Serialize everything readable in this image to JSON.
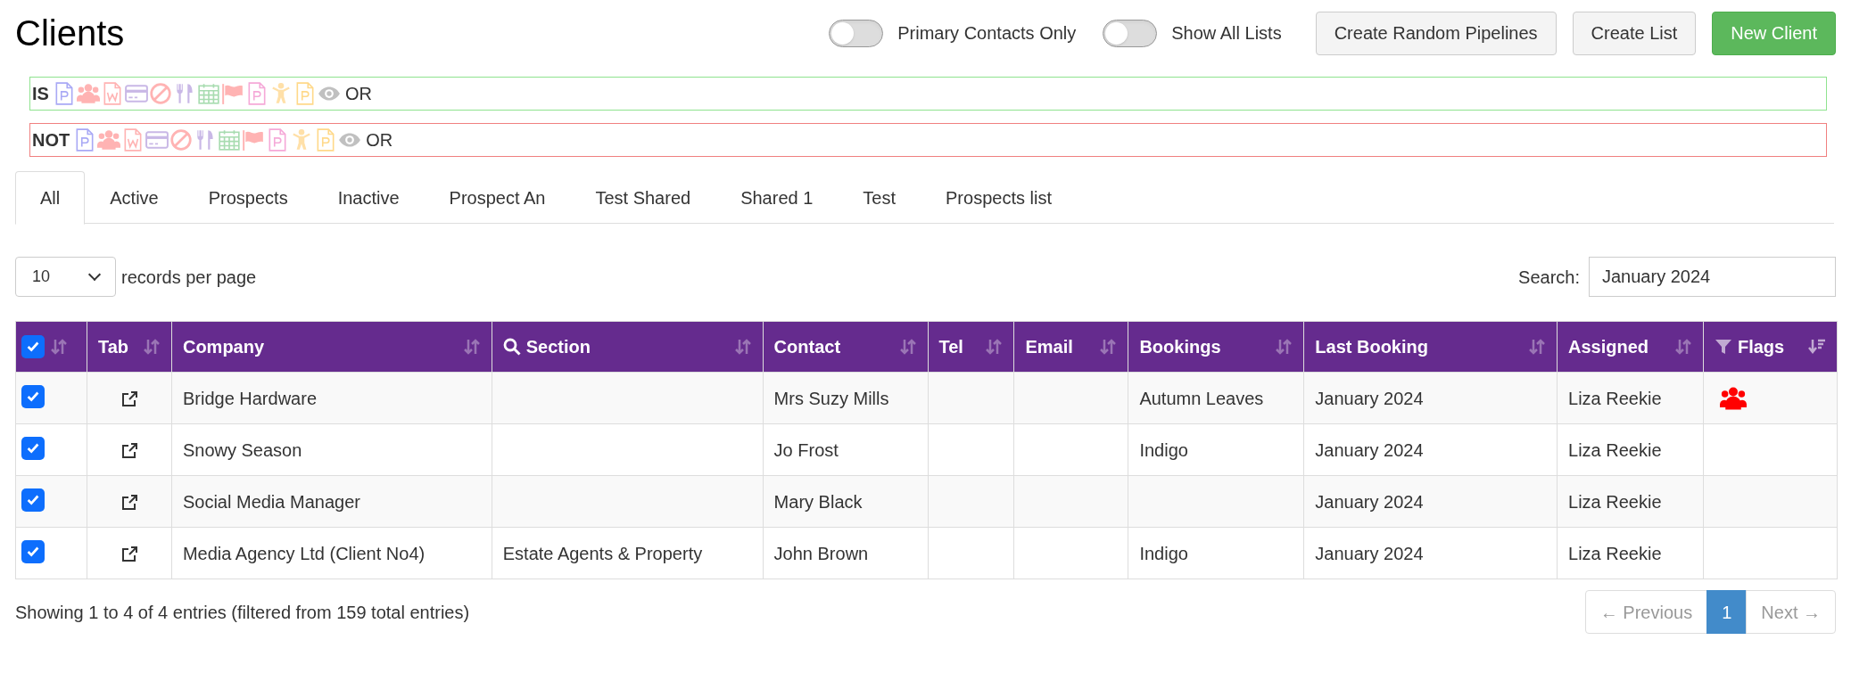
{
  "page_title": "Clients",
  "toggles": [
    {
      "label": "Primary Contacts Only",
      "on": false
    },
    {
      "label": "Show All Lists",
      "on": false
    }
  ],
  "buttons": [
    {
      "label": "Create Random Pipelines",
      "kind": "default"
    },
    {
      "label": "Create List",
      "kind": "default"
    },
    {
      "label": "New Client",
      "kind": "primary"
    }
  ],
  "filters": [
    {
      "label": "IS",
      "kind": "is",
      "joiner": "OR",
      "icons": [
        {
          "kind": "docp",
          "color": "#a9a9f5"
        },
        {
          "kind": "users",
          "color": "#ffb3b3"
        },
        {
          "kind": "docw",
          "color": "#ffb3b3"
        },
        {
          "kind": "card",
          "color": "#c9b8e6"
        },
        {
          "kind": "ban",
          "color": "#ffb3b3"
        },
        {
          "kind": "utensils",
          "color": "#c9b8e6"
        },
        {
          "kind": "calendar",
          "color": "#a8dcb0"
        },
        {
          "kind": "flag",
          "color": "#ffb3b3"
        },
        {
          "kind": "docp",
          "color": "#f5a9d8"
        },
        {
          "kind": "child",
          "color": "#ffe0a8"
        },
        {
          "kind": "docp",
          "color": "#ffd98a"
        },
        {
          "kind": "eye",
          "color": "#c0c0c0"
        }
      ]
    },
    {
      "label": "NOT",
      "kind": "not",
      "joiner": "OR",
      "icons": [
        {
          "kind": "docp",
          "color": "#a9a9f5"
        },
        {
          "kind": "users",
          "color": "#ffb3b3"
        },
        {
          "kind": "docw",
          "color": "#ffb3b3"
        },
        {
          "kind": "card",
          "color": "#c9b8e6"
        },
        {
          "kind": "ban",
          "color": "#ffb3b3"
        },
        {
          "kind": "utensils",
          "color": "#c9b8e6"
        },
        {
          "kind": "calendar",
          "color": "#a8dcb0"
        },
        {
          "kind": "flag",
          "color": "#ffb3b3"
        },
        {
          "kind": "docp",
          "color": "#f5a9d8"
        },
        {
          "kind": "child",
          "color": "#ffe0a8"
        },
        {
          "kind": "docp",
          "color": "#ffd98a"
        },
        {
          "kind": "eye",
          "color": "#c0c0c0"
        }
      ]
    }
  ],
  "tabs": [
    {
      "label": "All",
      "selected": true
    },
    {
      "label": "Active",
      "selected": false
    },
    {
      "label": "Prospects",
      "selected": false
    },
    {
      "label": "Inactive",
      "selected": false
    },
    {
      "label": "Prospect An",
      "selected": false
    },
    {
      "label": "Test Shared",
      "selected": false
    },
    {
      "label": "Shared 1",
      "selected": false
    },
    {
      "label": "Test",
      "selected": false
    },
    {
      "label": "Prospects list",
      "selected": false
    }
  ],
  "page_size": {
    "value": "10",
    "label": "records per page"
  },
  "search": {
    "label": "Search:",
    "value": "January 2024"
  },
  "table": {
    "all_checked": true,
    "columns": [
      {
        "label": "Tab",
        "kind": "plain",
        "sorted": false
      },
      {
        "label": "Company",
        "kind": "plain",
        "sorted": false
      },
      {
        "label": "Section",
        "kind": "search",
        "sorted": false
      },
      {
        "label": "Contact",
        "kind": "plain",
        "sorted": false
      },
      {
        "label": "Tel",
        "kind": "plain",
        "sorted": false
      },
      {
        "label": "Email",
        "kind": "plain",
        "sorted": false
      },
      {
        "label": "Bookings",
        "kind": "plain",
        "sorted": false
      },
      {
        "label": "Last Booking",
        "kind": "plain",
        "sorted": false
      },
      {
        "label": "Assigned",
        "kind": "plain",
        "sorted": false
      },
      {
        "label": "Flags",
        "kind": "filter",
        "sorted": true
      }
    ],
    "rows": [
      {
        "checked": true,
        "company": "Bridge Hardware",
        "section": "",
        "contact": "Mrs Suzy Mills",
        "tel": "",
        "email": "",
        "bookings": "Autumn Leaves",
        "last_booking": "January 2024",
        "assigned": "Liza Reekie",
        "flags": [
          {
            "kind": "users",
            "color": "#ff0000"
          }
        ]
      },
      {
        "checked": true,
        "company": "Snowy Season",
        "section": "",
        "contact": "Jo Frost",
        "tel": "",
        "email": "",
        "bookings": "Indigo",
        "last_booking": "January 2024",
        "assigned": "Liza Reekie",
        "flags": []
      },
      {
        "checked": true,
        "company": "Social Media Manager",
        "section": "",
        "contact": "Mary Black",
        "tel": "",
        "email": "",
        "bookings": "",
        "last_booking": "January 2024",
        "assigned": "Liza Reekie",
        "flags": []
      },
      {
        "checked": true,
        "company": "Media Agency Ltd (Client No4)",
        "section": "Estate Agents & Property",
        "contact": "John Brown",
        "tel": "",
        "email": "",
        "bookings": "Indigo",
        "last_booking": "January 2024",
        "assigned": "Liza Reekie",
        "flags": []
      }
    ]
  },
  "footer": {
    "summary": "Showing 1 to 4 of 4 entries (filtered from 159 total entries)"
  },
  "pagination": [
    {
      "label": "← Previous",
      "selected": false,
      "disabled": true
    },
    {
      "label": "1",
      "selected": true,
      "disabled": false
    },
    {
      "label": "Next →",
      "selected": false,
      "disabled": true
    }
  ]
}
